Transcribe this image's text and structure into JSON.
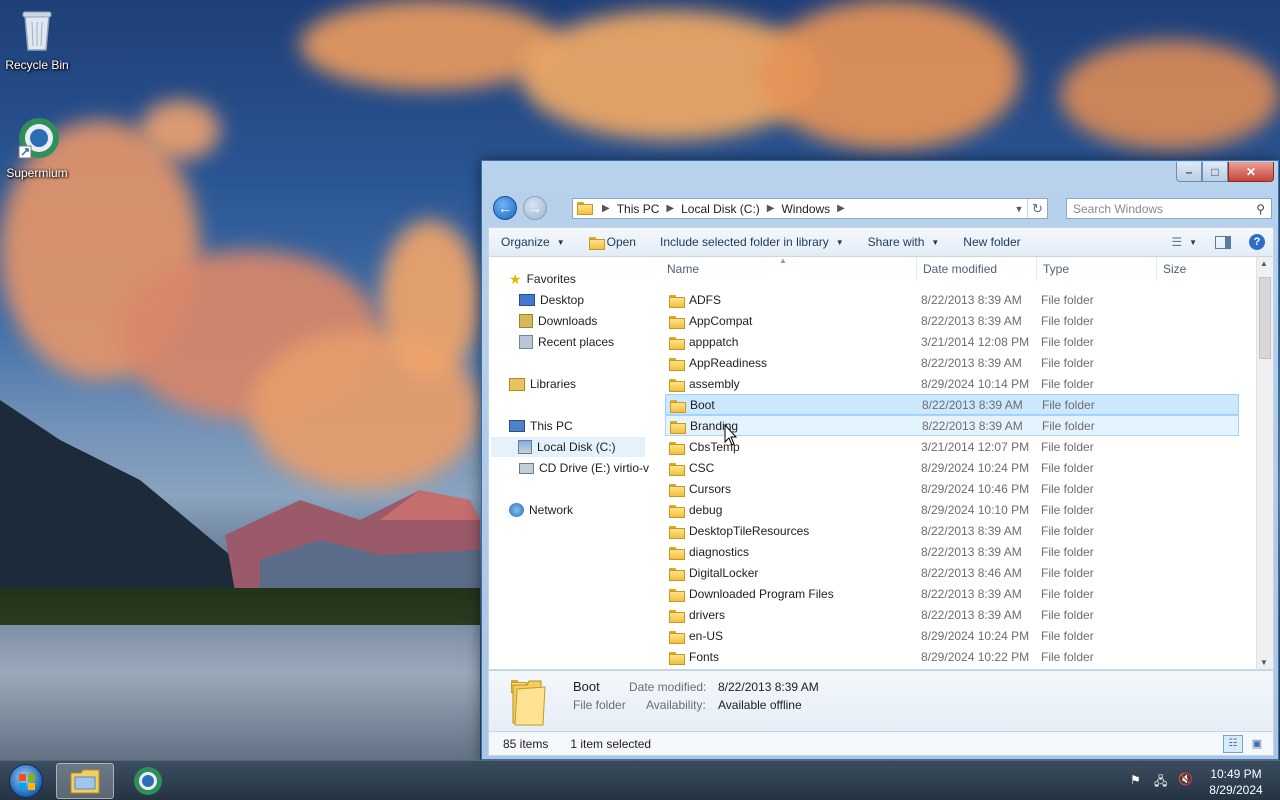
{
  "desktop": {
    "icons": [
      {
        "label": "Recycle Bin",
        "icon": "recycle-bin-icon"
      },
      {
        "label": "Supermium",
        "icon": "supermium-icon"
      }
    ]
  },
  "window": {
    "controls": {
      "minimize": "–",
      "maximize": "□",
      "close": "✕"
    },
    "address": {
      "crumbs": [
        "This PC",
        "Local Disk (C:)",
        "Windows"
      ]
    },
    "search": {
      "placeholder": "Search Windows"
    },
    "toolbar": {
      "organize": "Organize",
      "open": "Open",
      "include": "Include selected folder in library",
      "share": "Share with",
      "new_folder": "New folder"
    },
    "nav": {
      "favorites": "Favorites",
      "desktop": "Desktop",
      "downloads": "Downloads",
      "recent": "Recent places",
      "libraries": "Libraries",
      "thispc": "This PC",
      "localdisk": "Local Disk (C:)",
      "cddrive": "CD Drive (E:) virtio-v",
      "network": "Network"
    },
    "columns": {
      "name": "Name",
      "date": "Date modified",
      "type": "Type",
      "size": "Size"
    },
    "files": [
      {
        "name": "ADFS",
        "date": "8/22/2013 8:39 AM",
        "type": "File folder"
      },
      {
        "name": "AppCompat",
        "date": "8/22/2013 8:39 AM",
        "type": "File folder"
      },
      {
        "name": "apppatch",
        "date": "3/21/2014 12:08 PM",
        "type": "File folder"
      },
      {
        "name": "AppReadiness",
        "date": "8/22/2013 8:39 AM",
        "type": "File folder"
      },
      {
        "name": "assembly",
        "date": "8/29/2024 10:14 PM",
        "type": "File folder"
      },
      {
        "name": "Boot",
        "date": "8/22/2013 8:39 AM",
        "type": "File folder"
      },
      {
        "name": "Branding",
        "date": "8/22/2013 8:39 AM",
        "type": "File folder"
      },
      {
        "name": "CbsTemp",
        "date": "3/21/2014 12:07 PM",
        "type": "File folder"
      },
      {
        "name": "CSC",
        "date": "8/29/2024 10:24 PM",
        "type": "File folder"
      },
      {
        "name": "Cursors",
        "date": "8/29/2024 10:46 PM",
        "type": "File folder"
      },
      {
        "name": "debug",
        "date": "8/29/2024 10:10 PM",
        "type": "File folder"
      },
      {
        "name": "DesktopTileResources",
        "date": "8/22/2013 8:39 AM",
        "type": "File folder"
      },
      {
        "name": "diagnostics",
        "date": "8/22/2013 8:39 AM",
        "type": "File folder"
      },
      {
        "name": "DigitalLocker",
        "date": "8/22/2013 8:46 AM",
        "type": "File folder"
      },
      {
        "name": "Downloaded Program Files",
        "date": "8/22/2013 8:39 AM",
        "type": "File folder"
      },
      {
        "name": "drivers",
        "date": "8/22/2013 8:39 AM",
        "type": "File folder"
      },
      {
        "name": "en-US",
        "date": "8/29/2024 10:24 PM",
        "type": "File folder"
      },
      {
        "name": "Fonts",
        "date": "8/29/2024 10:22 PM",
        "type": "File folder"
      }
    ],
    "details": {
      "name": "Boot",
      "type": "File folder",
      "date_label": "Date modified:",
      "date_value": "8/22/2013 8:39 AM",
      "avail_label": "Availability:",
      "avail_value": "Available offline"
    },
    "status": {
      "count": "85 items",
      "selected": "1 item selected"
    }
  },
  "taskbar": {
    "clock_time": "10:49 PM",
    "clock_date": "8/29/2024"
  }
}
